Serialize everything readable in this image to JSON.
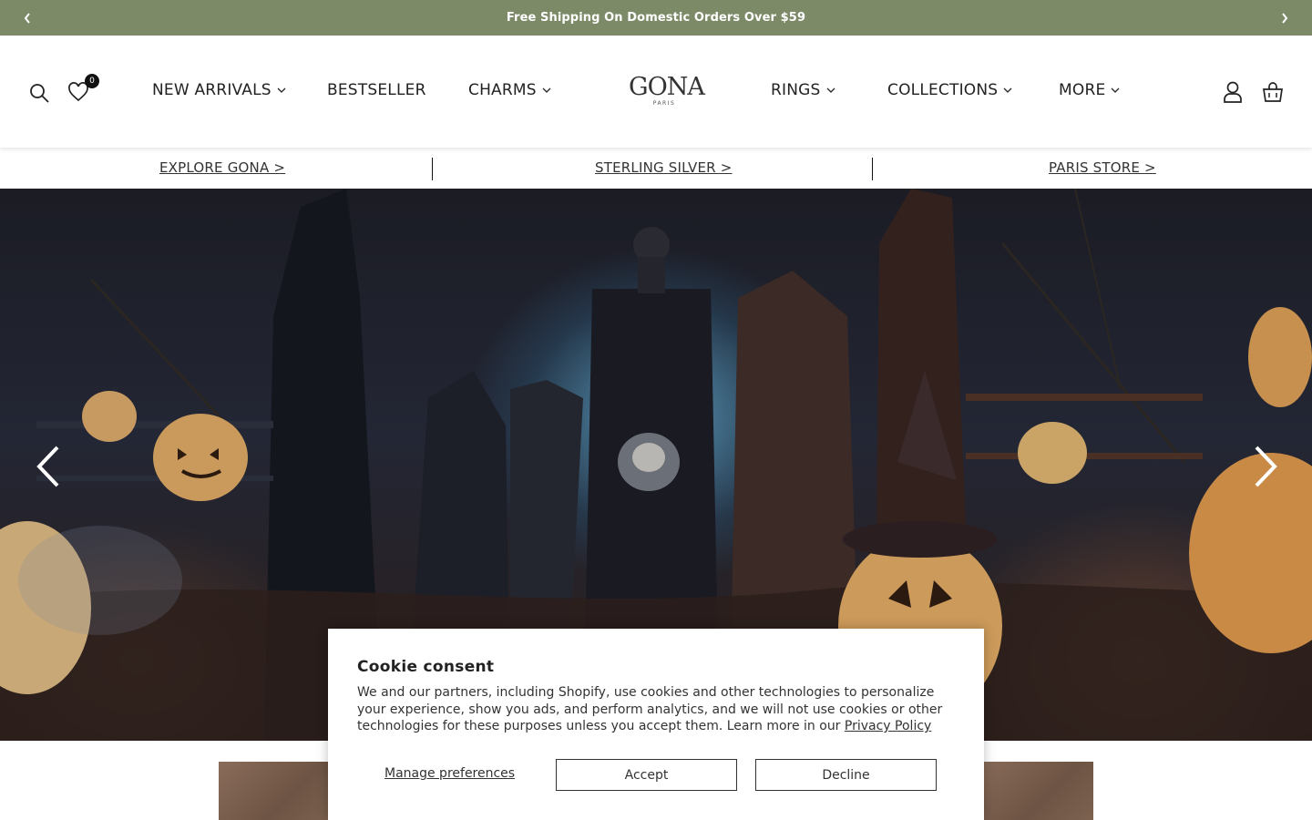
{
  "announcement": {
    "message": "Free Shipping On Domestic Orders Over $59",
    "prev_icon": "chevron-left-icon",
    "next_icon": "chevron-right-icon"
  },
  "header": {
    "wishlist_count": "0",
    "logo": {
      "wordmark": "GONA",
      "sub": "PARIS"
    },
    "nav": [
      {
        "label": "NEW ARRIVALS",
        "has_dropdown": true
      },
      {
        "label": "BESTSELLER",
        "has_dropdown": false
      },
      {
        "label": "CHARMS",
        "has_dropdown": true
      },
      {
        "label": "RINGS",
        "has_dropdown": true
      },
      {
        "label": "COLLECTIONS",
        "has_dropdown": true
      },
      {
        "label": "MORE",
        "has_dropdown": true
      }
    ],
    "icons": [
      "search-icon",
      "heart-icon",
      "account-icon",
      "cart-icon"
    ]
  },
  "sublinks": [
    {
      "label": "EXPLORE GONA >"
    },
    {
      "label": "STERLING SILVER >"
    },
    {
      "label": "PARIS STORE >"
    }
  ],
  "hero": {
    "scene": "Halloween graveyard with jack-o'-lantern pumpkins",
    "prev_icon": "chevron-left-icon",
    "next_icon": "chevron-right-icon"
  },
  "cookie": {
    "title": "Cookie consent",
    "body": "We and our partners, including Shopify, use cookies and other technologies to personalize your experience, show you ads, and perform analytics, and we will not use cookies or other technologies for these purposes unless you accept them. Learn more in our",
    "privacy_link": "Privacy Policy",
    "manage_label": "Manage preferences",
    "accept_label": "Accept",
    "decline_label": "Decline"
  },
  "colors": {
    "announcement_bg": "#7d8a68",
    "text": "#222222"
  }
}
